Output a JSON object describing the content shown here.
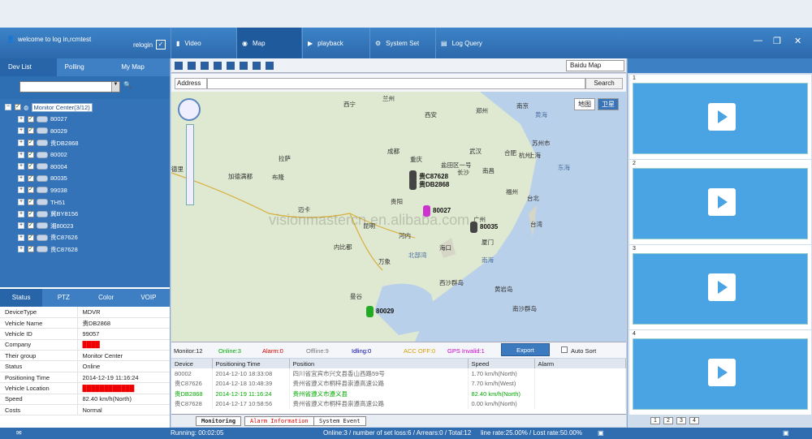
{
  "header": {
    "user": "welcome to log in,rcmtest",
    "relogin": "relogin",
    "nav": [
      {
        "label": "Video"
      },
      {
        "label": "Map"
      },
      {
        "label": "playback"
      },
      {
        "label": "System Set"
      },
      {
        "label": "Log Query"
      }
    ]
  },
  "left": {
    "tabs": [
      "Dev List",
      "Polling",
      "My Map"
    ],
    "tree_root": "Monitor Center(3/12)",
    "devices": [
      "80027",
      "80029",
      "贵DB2868",
      "80002",
      "80004",
      "80035",
      "99038",
      "TH51",
      "冀BY8156",
      "湘80023",
      "贵C87626",
      "贵C87628"
    ],
    "status_tabs": [
      "Status",
      "PTZ",
      "Color",
      "VOIP"
    ],
    "info": [
      [
        "DeviceType",
        "MDVR"
      ],
      [
        "Vehicle Name",
        "贵DB2868"
      ],
      [
        "Vehicle ID",
        "99057"
      ],
      [
        "Company",
        "████"
      ],
      [
        "Their group",
        "Monitor Center"
      ],
      [
        "Status",
        "Online"
      ],
      [
        "Positioning Time",
        "2014-12-19 11:16:24"
      ],
      [
        "Vehicle Location",
        "████████████"
      ],
      [
        "Speed",
        "82.40 km/h(North)"
      ],
      [
        "Costs",
        "Normal"
      ]
    ]
  },
  "map": {
    "provider": "Baidu Map",
    "address_label": "Address",
    "search": "Search",
    "view_map": "地图",
    "view_sat": "卫星",
    "places": [
      "兰州",
      "西宁",
      "西安",
      "郑州",
      "南京",
      "成都",
      "重庆",
      "盐田区一号",
      "武汉",
      "合肥",
      "杭州",
      "苏州市",
      "上海",
      "拉萨",
      "长沙",
      "南昌",
      "福州",
      "台北",
      "贵阳",
      "广州",
      "厦门",
      "加德满都",
      "布隆",
      "迈卡",
      "昆明",
      "内比都",
      "河内",
      "海口",
      "万象",
      "曼谷",
      "黄海",
      "东海",
      "南海",
      "北部湾",
      "西沙群岛",
      "黄岩岛",
      "南沙群岛",
      "台湾",
      "德里"
    ],
    "vehicle_labels": [
      "贵C87628",
      "贵DB2868",
      "80027",
      "80035",
      "80029"
    ],
    "watermark": "visionmastercn.en.alibaba.com"
  },
  "mapstatus": {
    "monitor": "Monitor:12",
    "online": "Online:3",
    "alarm": "Alarm:0",
    "offline": "Offline:9",
    "idling": "Idling:0",
    "acc_off": "ACC OFF:0",
    "gps_invalid": "GPS Invalid:1",
    "export": "Export",
    "auto_sort": "Auto Sort"
  },
  "grid": {
    "columns": [
      "Device",
      "Positioning Time",
      "Position",
      "Speed",
      "Alarm"
    ],
    "rows": [
      [
        "80002",
        "2014-12-10 18:33:08",
        "四川省宜宾市兴文县香山西路59号",
        "1.70 km/h(North)",
        ""
      ],
      [
        "贵C87626",
        "2014-12-18 10:48:39",
        "贵州省遵义市桐梓县崇遵高速公路",
        "7.70 km/h(West)",
        ""
      ],
      [
        "贵DB2868",
        "2014-12-19 11:16:24",
        "贵州省遵义市遵义县",
        "82.40 km/h(North)",
        ""
      ],
      [
        "贵C87628",
        "2014-12-17 10:58:56",
        "贵州省遵义市桐梓县崇遵高速公路",
        "0.00 km/h(North)",
        ""
      ]
    ],
    "tabs": [
      "Monitoring",
      "Alarm Information",
      "System Event"
    ]
  },
  "right": {
    "slots": [
      "1",
      "2",
      "3",
      "4"
    ],
    "pages": [
      "1",
      "2",
      "3",
      "4"
    ]
  },
  "status": {
    "running": "Running: 00:02:05",
    "online": "Online:3 / number of set loss:6 / Arrears:0 / Total:12",
    "rate": "line rate:25.00% / Lost rate:50.00%"
  }
}
